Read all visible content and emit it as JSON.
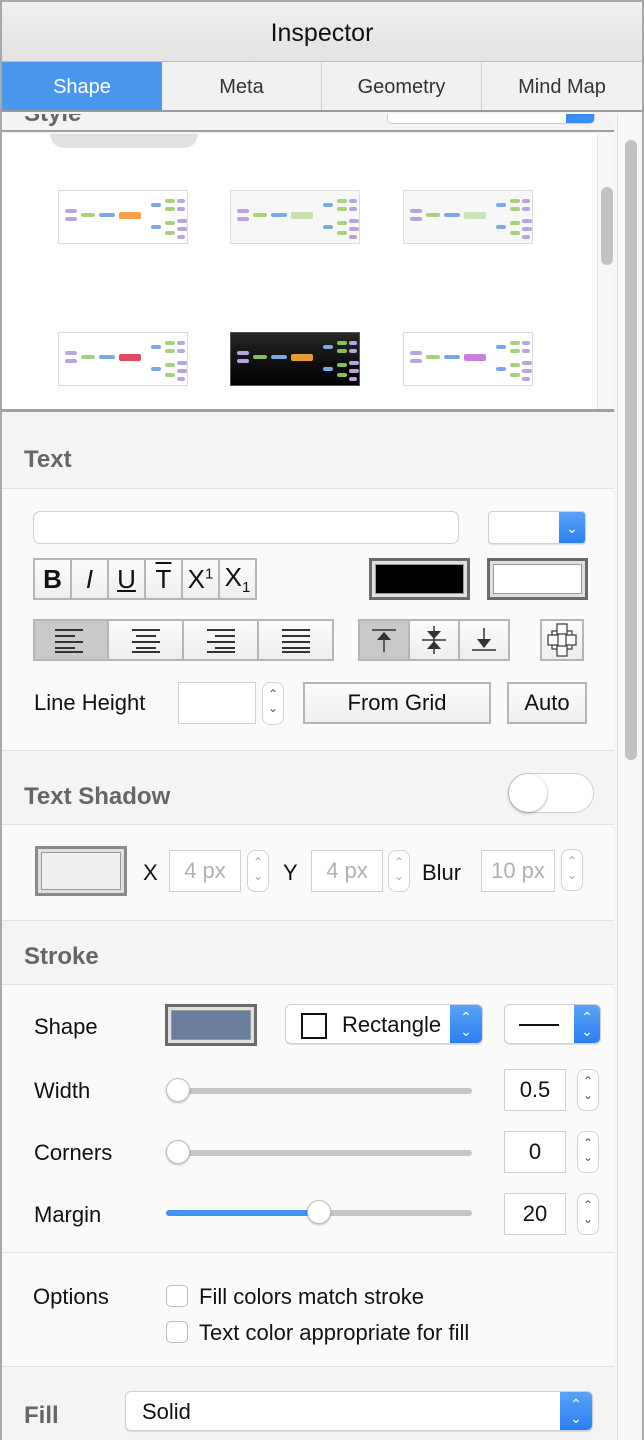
{
  "window": {
    "title": "Inspector"
  },
  "tabs": [
    {
      "label": "Shape",
      "active": true
    },
    {
      "label": "Meta",
      "active": false
    },
    {
      "label": "Geometry",
      "active": false
    },
    {
      "label": "Mind Map",
      "active": false
    }
  ],
  "style_section": {
    "label": "Style",
    "thumbnails": [
      {
        "name": "style-colorful-orange",
        "theme": "light",
        "center_color": "#f5a04a"
      },
      {
        "name": "style-pastel-green",
        "theme": "light-gray",
        "center_color": "#c8e0b0"
      },
      {
        "name": "style-pastel-mixed",
        "theme": "light-gray",
        "center_color": "#c8e6b8"
      },
      {
        "name": "style-red-oval",
        "theme": "light",
        "center_color": "#e04a5a"
      },
      {
        "name": "style-dark",
        "theme": "dark",
        "center_color": "#e89a3a"
      },
      {
        "name": "style-purple-minimal",
        "theme": "light",
        "center_color": "#c77fe0"
      }
    ]
  },
  "text_section": {
    "title": "Text",
    "font_field": {
      "value": "",
      "placeholder": ""
    },
    "size_dropdown": {
      "value": ""
    },
    "format_buttons": [
      {
        "name": "bold",
        "label": "B"
      },
      {
        "name": "italic",
        "label": "I"
      },
      {
        "name": "underline",
        "label": "U"
      },
      {
        "name": "strikethrough",
        "label": "T"
      },
      {
        "name": "superscript",
        "label": "X",
        "sub": "1"
      },
      {
        "name": "subscript",
        "label": "X",
        "sub": "1"
      }
    ],
    "text_color": "#000000",
    "background_color": "#ffffff",
    "align_buttons": [
      "align-left",
      "align-center",
      "align-right",
      "align-justify"
    ],
    "align_selected": "align-left",
    "valign_buttons": [
      "valign-top",
      "valign-middle",
      "valign-bottom"
    ],
    "valign_selected": "valign-top",
    "line_height_label": "Line Height",
    "line_height_value": "",
    "from_grid_label": "From Grid",
    "auto_label": "Auto"
  },
  "text_shadow_section": {
    "title": "Text Shadow",
    "enabled": false,
    "color": "#efefef",
    "x_label": "X",
    "x_value": "4 px",
    "y_label": "Y",
    "y_value": "4 px",
    "blur_label": "Blur",
    "blur_value": "10 px"
  },
  "stroke_section": {
    "title": "Stroke",
    "shape_label": "Shape",
    "shape_color": "#6a7f9f",
    "shape_type": "Rectangle",
    "line_style": "solid",
    "width_label": "Width",
    "width_value": "0.5",
    "width_fraction": 0.0,
    "corners_label": "Corners",
    "corners_value": "0",
    "corners_fraction": 0.0,
    "margin_label": "Margin",
    "margin_value": "20",
    "margin_fraction": 0.5
  },
  "options_section": {
    "label": "Options",
    "checkboxes": [
      {
        "label": "Fill colors match stroke",
        "checked": false
      },
      {
        "label": "Text color appropriate for fill",
        "checked": false
      }
    ]
  },
  "fill_section": {
    "title": "Fill",
    "value": "Solid"
  }
}
